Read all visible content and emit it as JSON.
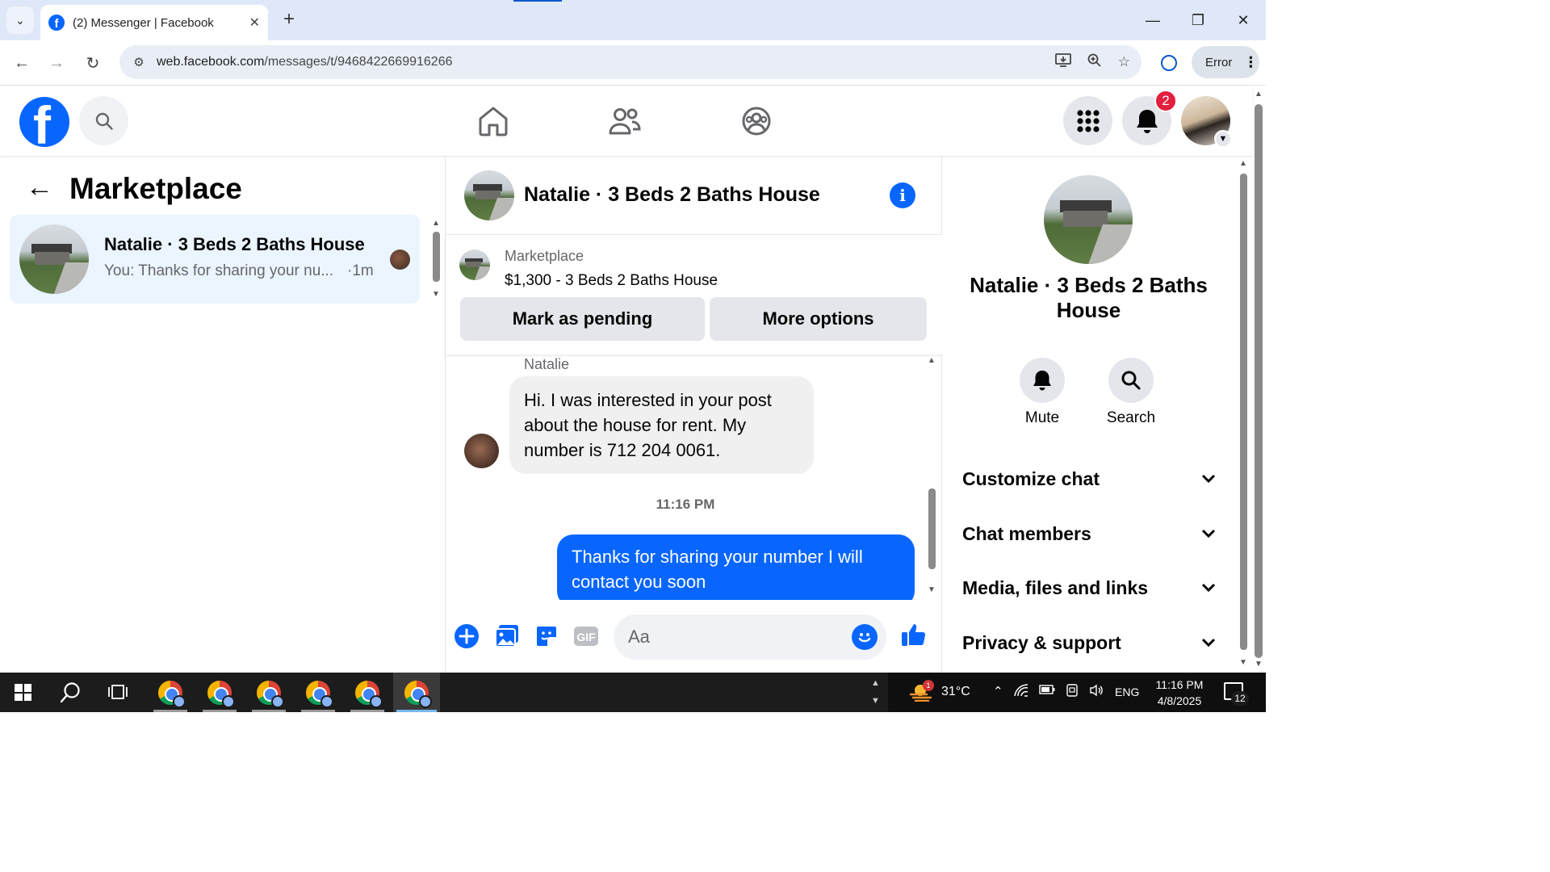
{
  "browser": {
    "tab_title": "(2) Messenger | Facebook",
    "url_domain": "web.facebook.com",
    "url_path": "/messages/t/9468422669916266",
    "profile_status": "Error"
  },
  "fb_nav": {
    "notification_count": "2"
  },
  "left_panel": {
    "title": "Marketplace",
    "conversations": [
      {
        "name": "Natalie · 3 Beds 2 Baths House",
        "preview": "You: Thanks for sharing your nu...",
        "time": "·1m"
      }
    ]
  },
  "chat": {
    "title": "Natalie · 3 Beds 2 Baths House",
    "listing": {
      "label": "Marketplace",
      "description": "$1,300 - 3 Beds 2 Baths House",
      "mark_pending_label": "Mark as pending",
      "more_options_label": "More options"
    },
    "messages": [
      {
        "sender": "Natalie",
        "direction": "incoming",
        "text": "Hi. I was interested in your post about the house for rent. My number is 712 204 0061."
      },
      {
        "timestamp": "11:16 PM"
      },
      {
        "direction": "outgoing",
        "text": "Thanks for sharing your number I will contact you soon"
      }
    ],
    "composer_placeholder": "Aa"
  },
  "details_panel": {
    "title": "Natalie · 3 Beds 2 Baths House",
    "actions": [
      {
        "label": "Mute",
        "icon": "bell-icon"
      },
      {
        "label": "Search",
        "icon": "search-icon"
      }
    ],
    "sections": [
      "Customize chat",
      "Chat members",
      "Media, files and links",
      "Privacy & support"
    ]
  },
  "taskbar": {
    "temperature": "31°C",
    "language": "ENG",
    "time": "11:16 PM",
    "date": "4/8/2025",
    "notification_count": "12",
    "weather_badge": "1"
  },
  "colors": {
    "facebook_blue": "#0866ff",
    "selected_conversation_bg": "#ebf5ff",
    "badge_red": "#e41e3f"
  }
}
